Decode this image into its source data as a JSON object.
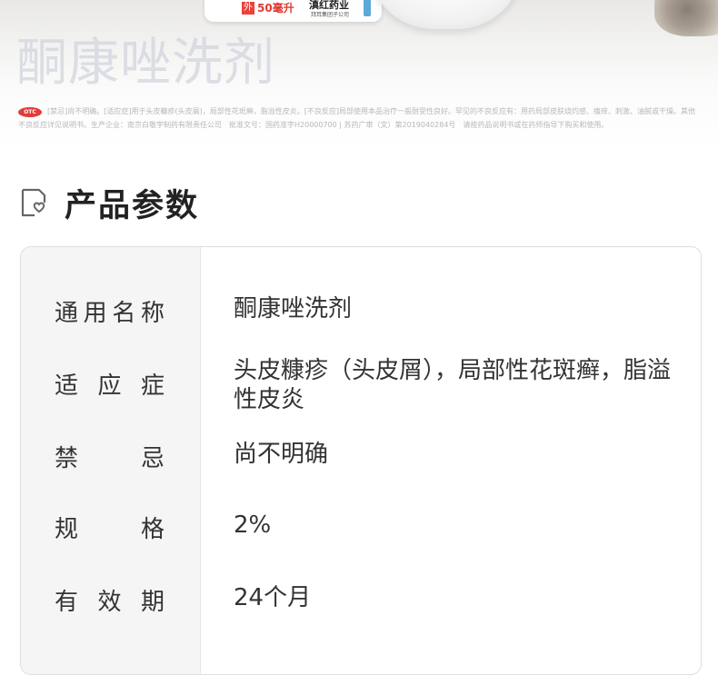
{
  "banner": {
    "spec_badge": "外",
    "spec_volume": "50毫升",
    "maker_mark": "滇红药业",
    "maker_sub": "拜耳集团子公司",
    "product_name": "酮康唑洗剂",
    "otc_badge": "OTC",
    "notice": "[禁忌]尚不明确。[适应症]用于头皮糠疹(头皮屑)，局部性花斑癣，脂溢性皮炎。[不良反应]局部使用本品治疗一般耐受性良好。罕见的不良反应有：用药局部皮肤烧灼感、瘙痒、刺激、油腻或干燥。其他不良反应详见说明书。生产企业：南京白敬宇制药有限责任公司　批准文号：国药准字H20000700 | 苏药广审（文）第2019040284号　请按药品说明书或在药师指导下购买和使用。"
  },
  "section": {
    "title": "产品参数",
    "icon": "heart-document-icon"
  },
  "params": [
    {
      "label_chars": [
        "通",
        "用",
        "名",
        "称"
      ],
      "value": "酮康唑洗剂"
    },
    {
      "label_chars": [
        "适",
        "应",
        "症"
      ],
      "value": "头皮糠疹（头皮屑），局部性花斑癣，脂溢性皮炎"
    },
    {
      "label_chars": [
        "禁",
        "忌"
      ],
      "value": "尚不明确"
    },
    {
      "label_chars": [
        "规",
        "格"
      ],
      "value": "2%"
    },
    {
      "label_chars": [
        "有",
        "效",
        "期"
      ],
      "value": "24个月"
    }
  ],
  "colors": {
    "accent_red": "#e23b3b",
    "watermark": "#d2d4de",
    "label_bg": "#f5f5f5",
    "border": "#dedede"
  }
}
